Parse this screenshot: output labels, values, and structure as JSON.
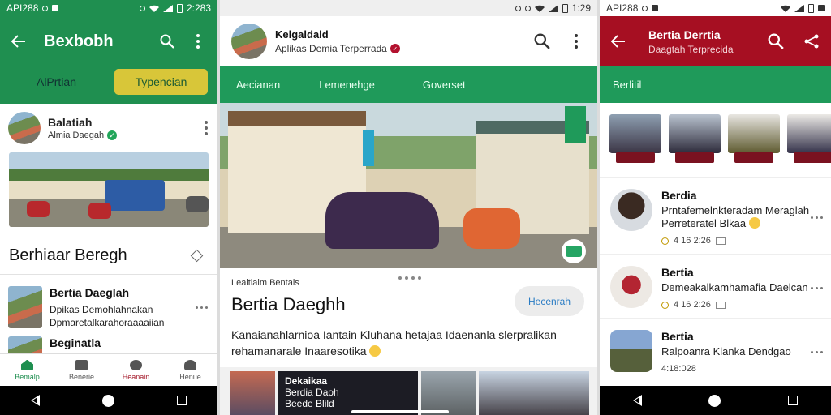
{
  "status_bar": {
    "left_phone": {
      "carrier": "API288",
      "time": "2:283"
    },
    "middle_phone": {
      "time": "1:29"
    },
    "right_phone": {
      "carrier": "API288"
    }
  },
  "phone_left": {
    "appbar": {
      "title": "Bexbobh"
    },
    "tabs": [
      {
        "label": "AlPrtian",
        "active": false
      },
      {
        "label": "Typencian",
        "active": true
      }
    ],
    "post": {
      "author": "Balatiah",
      "handle": "Almia Daegah",
      "title": "Berhiaar Beregh"
    },
    "list": [
      {
        "title": "Bertia Daeglah",
        "line1": "Dpikas Demohlahnakan",
        "line2": "Dpmaretalkarahoraaaaiian"
      },
      {
        "title": "Beginatla",
        "line1": "",
        "line2": ""
      }
    ],
    "bottom_nav": [
      {
        "label": "Bemalp",
        "icon": "home-icon",
        "active": true
      },
      {
        "label": "Benerie",
        "icon": "tv-icon",
        "active": false
      },
      {
        "label": "Heanain",
        "icon": "pin-icon",
        "active": false
      },
      {
        "label": "Henue",
        "icon": "person-icon",
        "active": false
      }
    ]
  },
  "phone_middle": {
    "header": {
      "title": "Kelgaldald",
      "subtitle": "Aplikas Demia Terperrada"
    },
    "tabs": [
      "Aecianan",
      "Lemenehge",
      "Goverset"
    ],
    "hero_badge": "app-icon",
    "card": {
      "source": "Leaitlalm Bentals",
      "headline": "Bertia Daeghh",
      "follow_label": "Hecenrah",
      "description": "Kanaianahlarnioa Iantain Kluhana hetajaa Idaenanla slerpralikan rehamanarale Inaaresotika"
    },
    "strip": {
      "line1": "Dekaikaa",
      "line2": "Berdia Daoh",
      "line3": "Beede Blild"
    }
  },
  "phone_right": {
    "appbar": {
      "title": "Bertia Derrtia",
      "subtitle": "Daagtah Terprecida"
    },
    "tab": "Berlitil",
    "items": [
      {
        "title": "Berdia",
        "desc": "Prntafemelnkteradam Meraglah Perreteratel Blkaa",
        "time": "4 16 2:26"
      },
      {
        "title": "Bertia",
        "desc": "Demeakalkamhamafia Daelcan",
        "time": "4 16 2:26"
      },
      {
        "title": "Bertia",
        "desc": "Ralpoanra Klanka Dendgao",
        "time": "4:18:028"
      }
    ]
  },
  "colors": {
    "green_primary": "#1f8f50",
    "tab_active_yellow": "#d8c639",
    "red_primary": "#a60f22"
  }
}
